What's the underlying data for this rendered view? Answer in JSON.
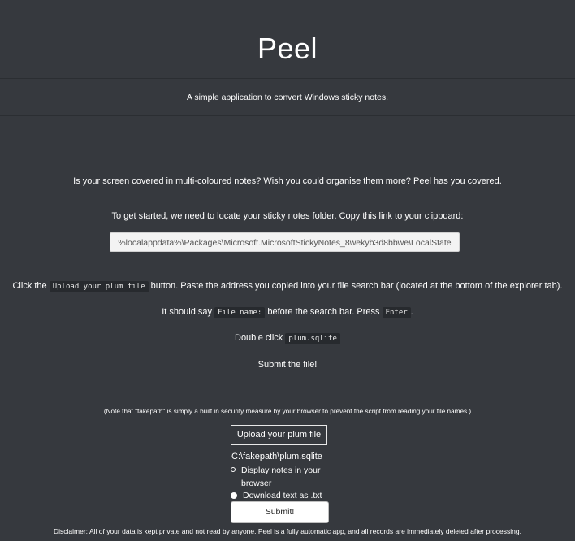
{
  "header": {
    "title": "Peel"
  },
  "subtitle": "A simple application to convert Windows sticky notes.",
  "intro": "Is your screen covered in multi-coloured notes? Wish you could organise them more? Peel has you covered.",
  "getting_started": "To get started, we need to locate your sticky notes folder. Copy this link to your clipboard:",
  "path_box": "%localappdata%\\Packages\\Microsoft.MicrosoftStickyNotes_8wekyb3d8bbwe\\LocalState",
  "instructions": {
    "line1_prefix": "Click the",
    "line1_code": "Upload your plum file",
    "line1_suffix": "button. Paste the address you copied into your file search bar (located at the bottom of the explorer tab).",
    "line2_prefix": "It should say",
    "line2_code": "File name:",
    "line2_middle": "before the search bar. Press",
    "line2_code2": "Enter",
    "line2_suffix": ".",
    "line3_prefix": "Double click",
    "line3_code": "plum.sqlite",
    "line4": "Submit the file!"
  },
  "note": "(Note that \"fakepath\" is simply a built in security measure by your browser to prevent the script from reading your file names.)",
  "upload_button": "Upload your plum file",
  "file_path": "C:\\fakepath\\plum.sqlite",
  "options": {
    "display": "Display notes in your browser",
    "download": "Download text as .txt",
    "selected": "download"
  },
  "submit_button": "Submit!",
  "disclaimer": "Disclaimer: All of your data is kept private and not read by anyone. Peel is a fully automatic app, and all records are immediately deleted after processing."
}
